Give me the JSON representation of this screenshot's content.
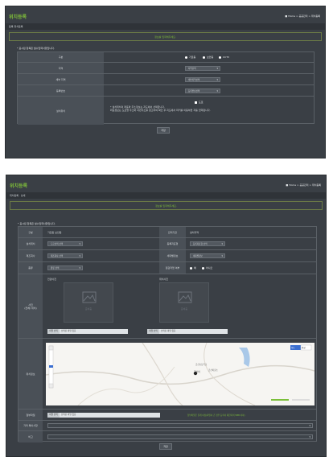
{
  "panel1": {
    "title": "위치등록",
    "breadcrumb": "■ Home > 공공관리 > 위치등록",
    "subheader": "등록 위치등록",
    "notice": "정보를 입력해주세요.",
    "required_note": "* 표시된 항목은 필수입력사항입니다.",
    "rows": [
      {
        "label": "구분",
        "radios": [
          "가로등",
          "보안등",
          "CCTV"
        ]
      },
      {
        "label": "지역",
        "select": "지역선택"
      },
      {
        "label": "세부 지역",
        "select": "세부지역선택"
      },
      {
        "label": "등록번호",
        "select": "등록번호선택"
      },
      {
        "label": "설치위치",
        "check": "도로",
        "notes": [
          "* 설치위치의 좌표와 주소정보는 지도에서 선택합니다.",
          "좌표정보는 도로명 주소와 지번주소를 참고하여 확인 후 지도에서 마커를 이동하면 자동 입력됩니다."
        ]
      }
    ],
    "submit": "저장"
  },
  "panel2": {
    "title": "위치등록",
    "breadcrumb": "■ Home > 공공관리 > 위치등록",
    "subheader": "위치등록 · 상세",
    "notice": "정보를 입력해주세요.",
    "required_note": "* 표시된 항목은 필수입력사항입니다.",
    "rows": {
      "r1": {
        "l1": "구분",
        "v1": "가로등 보안등",
        "l2": "관리기관",
        "v2": "설치지역"
      },
      "r2": {
        "l1": "설치위치",
        "v1": "도로선택 선택",
        "l2": "등록지표형",
        "v2": "등록지표형 선택"
      },
      "r3": {
        "l1": "제조회사",
        "v1": "제조회사 선택",
        "l2": "세대별정보",
        "v2": "세대별정보"
      },
      "r4": {
        "l1": "종류",
        "v1": "종류 선택",
        "l2": "점검작업 여부",
        "radios": [
          "예",
          "아니오"
        ]
      },
      "photo": {
        "label": "사진\n(전체/ 위치)",
        "left_caption": "전경사진",
        "right_caption": "위치사진",
        "placeholder": "준비중",
        "file_button": "파일 선택",
        "file_text": "선택된 파일 없음"
      },
      "map": {
        "label": "위치정보",
        "place1": "금산리",
        "place2": "금산초등학교",
        "place3": "금산파출소",
        "map_btn": "지도",
        "sat_btn": "위성"
      },
      "attach": {
        "label": "첨부파일",
        "file_button": "파일 선택",
        "file_text": "선택된 파일 없음",
        "help": "첨부파일은 한개 이상(파일이 큰 경우 등록이 제한되며 5MB 이하)"
      },
      "etc": {
        "label": "기타 특이사항"
      },
      "memo": {
        "label": "비고"
      }
    },
    "submit": "저장"
  },
  "colors": {
    "bg": "#3a3f45",
    "accent": "#7fbf3a",
    "label_bg": "#4a5057"
  }
}
